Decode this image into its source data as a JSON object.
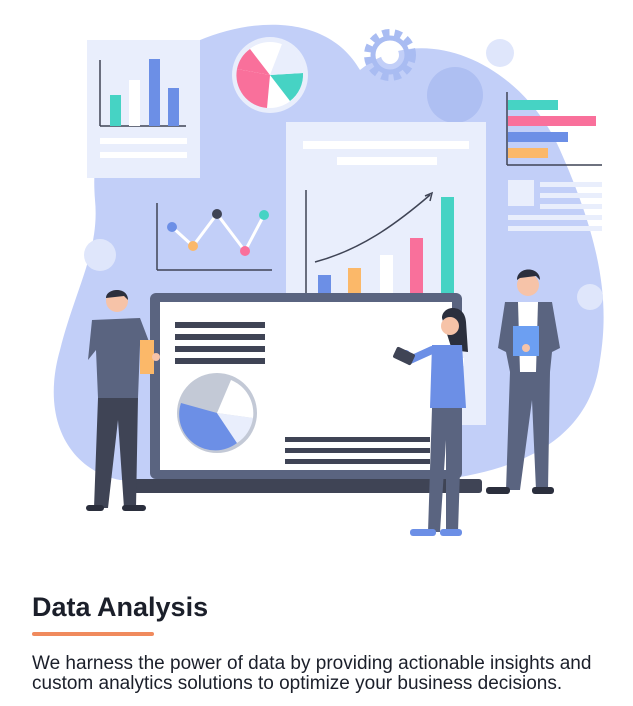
{
  "card": {
    "title": "Data Analysis",
    "description": "We harness the power of data by providing actionable insights and custom analytics solutions to optimize your business decisions.",
    "accent_color": "#f08a5d"
  },
  "illustration": {
    "palette": {
      "blob": "#c2cff8",
      "panel": "#e9eefc",
      "blue": "#6c8fe6",
      "teal": "#46d3c4",
      "pink": "#f9709b",
      "orange": "#fbb869",
      "dark": "#3f4455",
      "figure": "#5a6480",
      "skin": "#f6c3a8"
    },
    "icons": [
      "gear-icon",
      "pie-chart-icon",
      "bar-chart-icon",
      "line-chart-icon",
      "laptop-icon",
      "phone-icon",
      "clipboard-icon"
    ]
  }
}
